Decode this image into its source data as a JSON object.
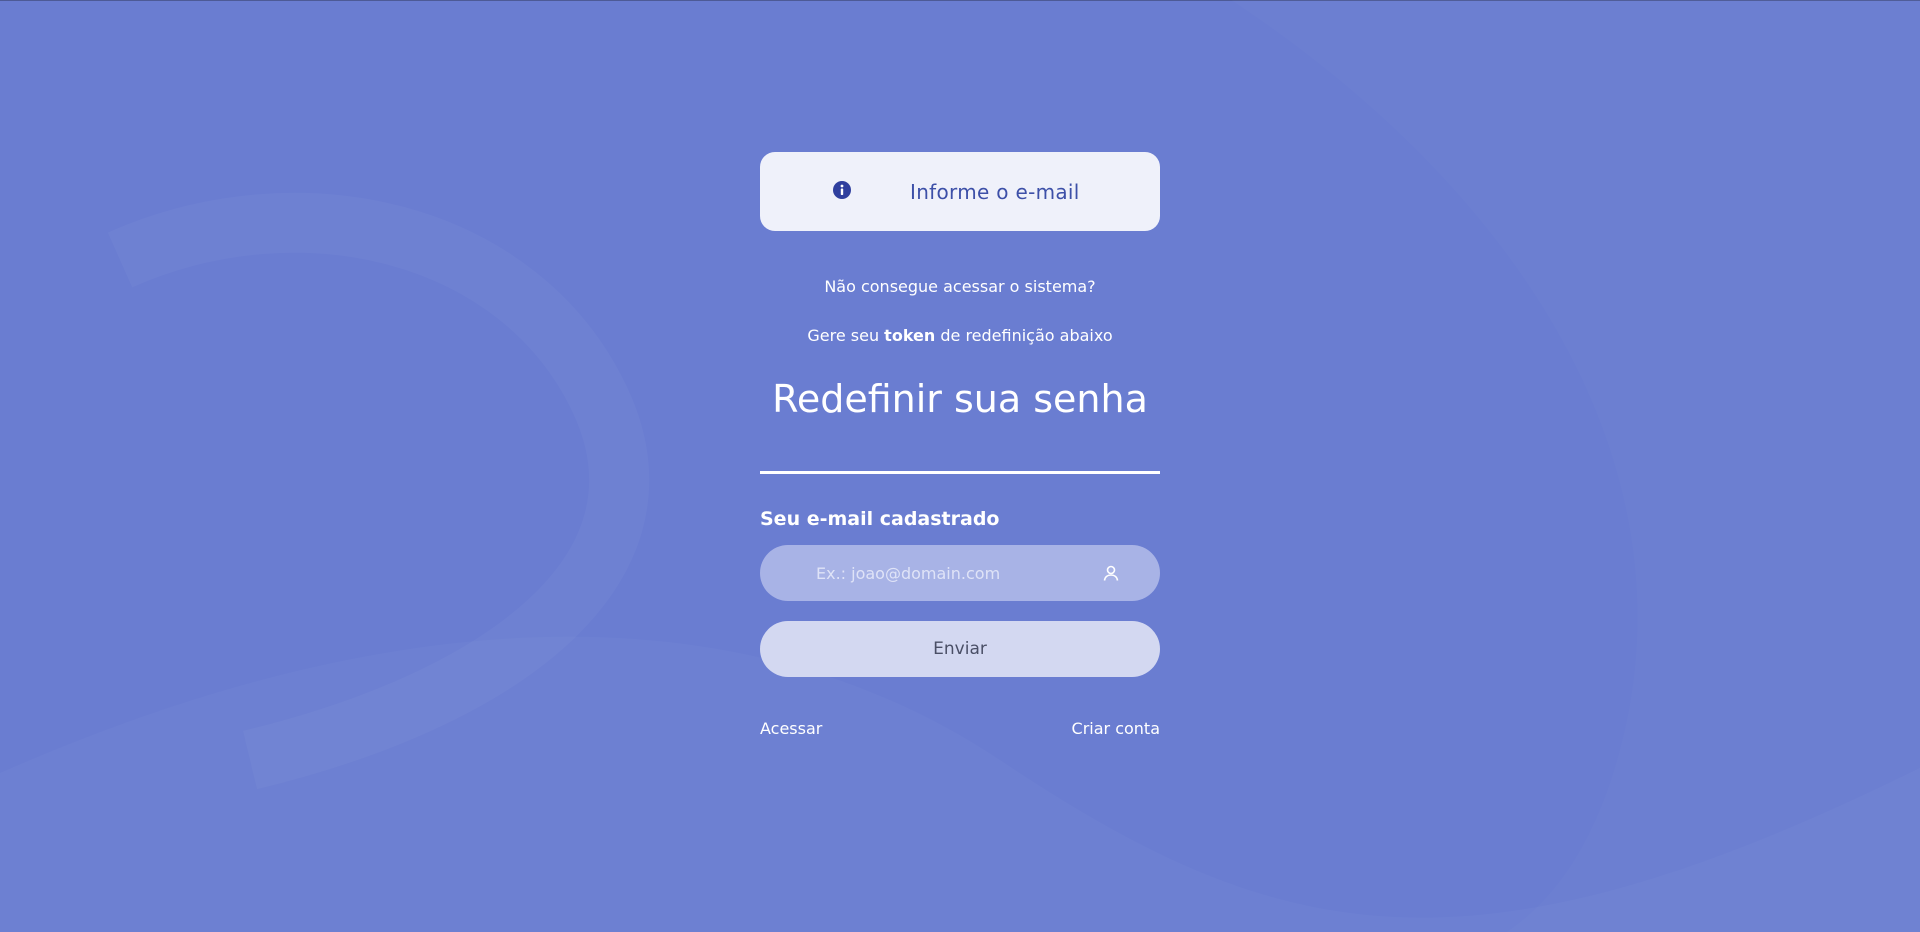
{
  "alert": {
    "icon": "info-icon",
    "text": "Informe o e-mail"
  },
  "help": {
    "question": "Não consegue acessar o sistema?",
    "token_prefix": "Gere seu",
    "token_bold": "token",
    "token_suffix": "de redefinição abaixo"
  },
  "page_title": "Redefinir sua senha",
  "form": {
    "email_label": "Seu e-mail cadastrado",
    "email_placeholder": "Ex.: joao@domain.com",
    "email_value": "",
    "email_icon": "user-icon",
    "submit_label": "Enviar"
  },
  "links": {
    "login": "Acessar",
    "signup": "Criar conta"
  },
  "colors": {
    "background": "#6a7dd1",
    "alert_background": "#eff1fa",
    "alert_text": "#3d50a8",
    "input_background": "#a8b3e6",
    "button_background": "#d3d8f1"
  }
}
